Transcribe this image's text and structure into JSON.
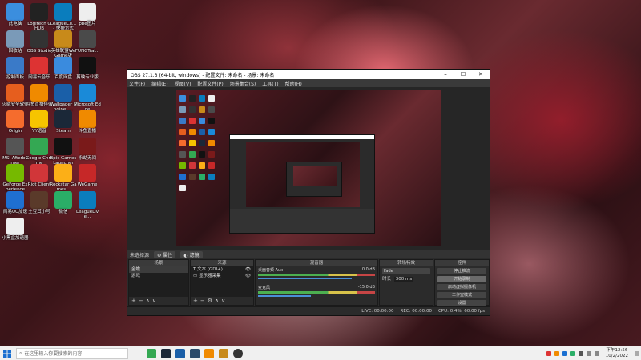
{
  "desktop_icons": [
    {
      "label": "此电脑",
      "color": "#3b8ede"
    },
    {
      "label": "Logitech G HUB",
      "color": "#222"
    },
    {
      "label": "LeagueCli... - 快捷方式",
      "color": "#0a7dbd"
    },
    {
      "label": "pbe图片",
      "color": "#eee"
    },
    {
      "label": "回收站",
      "color": "#7a9ab8"
    },
    {
      "label": "OBS Studio",
      "color": "#333"
    },
    {
      "label": "英雄联盟WeGame版",
      "color": "#c88a1a"
    },
    {
      "label": "FUNGTrai...",
      "color": "#4a4a4a"
    },
    {
      "label": "控制面板",
      "color": "#3a7ac8"
    },
    {
      "label": "网易云音乐",
      "color": "#d33"
    },
    {
      "label": "百度网盘",
      "color": "#3a8bde"
    },
    {
      "label": "剪映专业版",
      "color": "#111"
    },
    {
      "label": "火绒安全软件",
      "color": "#e65e1e"
    },
    {
      "label": "斗鱼直播伴侣",
      "color": "#f08a00"
    },
    {
      "label": "Wallpaper Engine: ...",
      "color": "#1a5fa8"
    },
    {
      "label": "Microsoft Edge",
      "color": "#1a8ad8"
    },
    {
      "label": "Origin",
      "color": "#f56c2d"
    },
    {
      "label": "YY语音",
      "color": "#f6c400"
    },
    {
      "label": "Steam",
      "color": "#1b2838"
    },
    {
      "label": "斗鱼直播",
      "color": "#f08a00"
    },
    {
      "label": "MSI Afterburner",
      "color": "#555"
    },
    {
      "label": "Google Chrome",
      "color": "#34a853"
    },
    {
      "label": "Epic Games Launcher",
      "color": "#111"
    },
    {
      "label": "永劫无间",
      "color": "#7a1a1a"
    },
    {
      "label": "GeForce Experience",
      "color": "#76b900"
    },
    {
      "label": "Riot Client",
      "color": "#d13639"
    },
    {
      "label": "Rockstar Games...",
      "color": "#fcaf17"
    },
    {
      "label": "WeGame",
      "color": "#c62828"
    },
    {
      "label": "网易UU加速",
      "color": "#1f6fd1"
    },
    {
      "label": "土豆其小号",
      "color": "#5a3a2a"
    },
    {
      "label": "微信",
      "color": "#2aae67"
    },
    {
      "label": "LeagueLive...",
      "color": "#0a7dbd"
    },
    {
      "label": "小黑盒加速器",
      "color": "#eee"
    }
  ],
  "obs": {
    "title": "OBS 27.1.3 (64-bit, windows) - 配置文件: 未命名 - 场景: 未命名",
    "menu": [
      "文件(F)",
      "编辑(E)",
      "视图(V)",
      "配置文件(P)",
      "场景集合(S)",
      "工具(T)",
      "帮助(H)"
    ],
    "scene_bar_label": "未选择源",
    "props_btn": "属性",
    "filters_btn": "滤镜",
    "docks": {
      "scenes": {
        "title": "场景",
        "items": [
          "金蟾",
          "游戏"
        ]
      },
      "sources": {
        "title": "来源",
        "items": [
          "文本 (GDI+)",
          "显示器采集"
        ]
      },
      "mixer": {
        "title": "混音器",
        "channels": [
          {
            "name": "桌面音频 Aux",
            "db": "0.0 dB"
          },
          {
            "name": "麦克风",
            "db": "-15.0 dB"
          }
        ]
      },
      "transitions": {
        "title": "转场特效",
        "type": "Fade",
        "duration_label": "时长",
        "duration": "300 ms"
      },
      "controls": {
        "title": "控件",
        "buttons": [
          "停止推流",
          "开始录制",
          "启动虚拟摄像机",
          "工作室模式",
          "设置",
          "退出"
        ]
      }
    },
    "status": {
      "live": "LIVE: 00:00:00",
      "rec": "REC: 00:00:00",
      "cpu": "CPU: 0.4%, 60.00 fps"
    }
  },
  "taskbar": {
    "search_placeholder": "在这里输入你要搜索的内容",
    "time": "下午12:56",
    "date": "10/2/2022"
  }
}
